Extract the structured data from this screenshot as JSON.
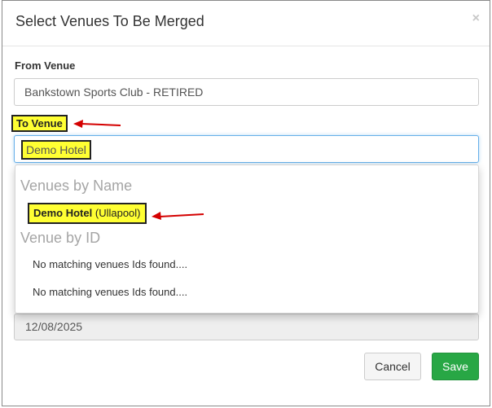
{
  "modal": {
    "title": "Select Venues To Be Merged",
    "close_glyph": "×"
  },
  "from_venue": {
    "label": "From Venue",
    "value": "Bankstown Sports Club - RETIRED"
  },
  "to_venue": {
    "label": "To Venue",
    "value": "Demo Hotel"
  },
  "dropdown": {
    "by_name_header": "Venues by Name",
    "option_name": "Demo Hotel",
    "option_suffix": "(Ullapool)",
    "by_id_header": "Venue by ID",
    "no_match_1": "No matching venues Ids found....",
    "no_match_2": "No matching venues Ids found...."
  },
  "date": {
    "value": "12/08/2025"
  },
  "footer": {
    "cancel_label": "Cancel",
    "save_label": "Save"
  },
  "colors": {
    "highlight": "#ffff33",
    "annotation_arrow": "#d40000",
    "save_button": "#28a745"
  }
}
